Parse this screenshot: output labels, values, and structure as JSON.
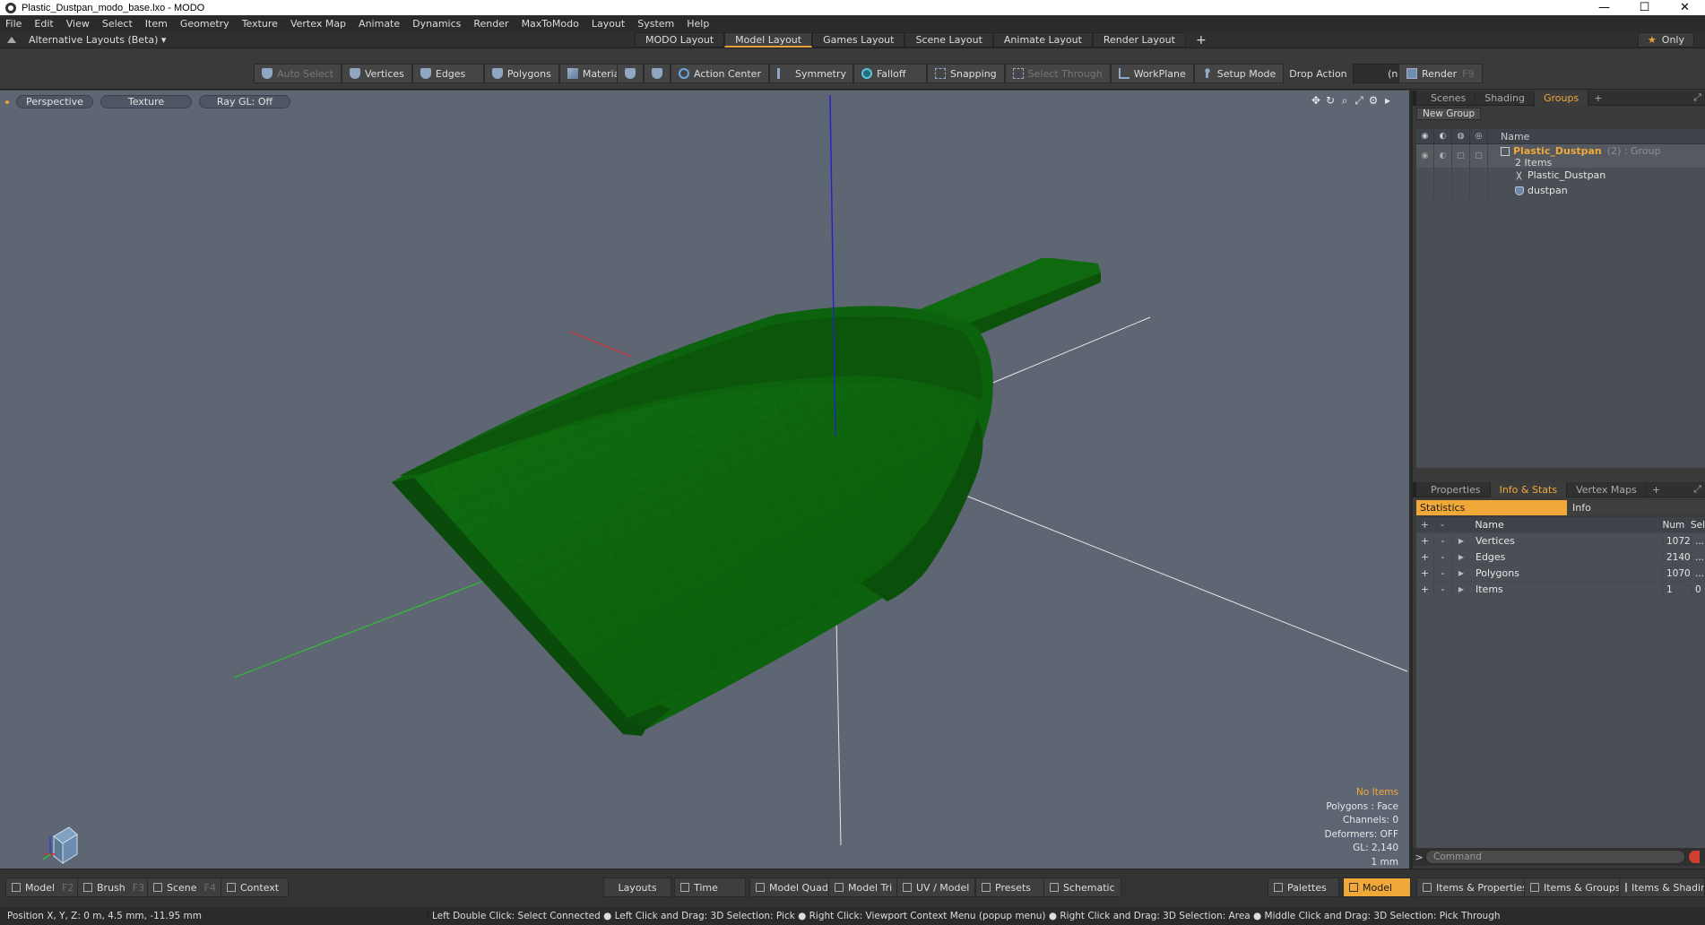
{
  "window": {
    "title": "Plastic_Dustpan_modo_base.lxo - MODO",
    "controls": [
      "—",
      "☐",
      "✕"
    ]
  },
  "menu": [
    "File",
    "Edit",
    "View",
    "Select",
    "Item",
    "Geometry",
    "Texture",
    "Vertex Map",
    "Animate",
    "Dynamics",
    "Render",
    "MaxToModo",
    "Layout",
    "System",
    "Help"
  ],
  "layoutbar": {
    "alt_layouts": "Alternative Layouts (Beta) ▾",
    "tabs": [
      "MODO Layout",
      "Model Layout",
      "Games Layout",
      "Scene Layout",
      "Animate Layout",
      "Render Layout"
    ],
    "active_tab": "Model Layout",
    "add": "+",
    "only": "Only"
  },
  "toolbar": {
    "auto_select": "Auto Select",
    "vertices": "Vertices",
    "edges": "Edges",
    "polygons": "Polygons",
    "materials": "Materials",
    "action_center": "Action Center",
    "symmetry": "Symmetry",
    "falloff": "Falloff",
    "snapping": "Snapping",
    "select_through": "Select Through",
    "workplane": "WorkPlane",
    "setup_mode": "Setup Mode",
    "drop_action_label": "Drop Action",
    "drop_action_value": "(none)",
    "render": "Render",
    "render_key": "F9"
  },
  "viewport": {
    "view": "Perspective",
    "shading": "Texture",
    "raygl": "Ray GL: Off",
    "info": {
      "selection": "No Items",
      "polygons": "Polygons : Face",
      "channels": "Channels: 0",
      "deformers": "Deformers: OFF",
      "gl": "GL: 2,140",
      "unit": "1 mm"
    },
    "colors": {
      "background": "#5e6674",
      "mesh": "#0f6b0f",
      "x_axis": "#d03030",
      "y_axis": "#2222cc",
      "z_axis": "#30c030"
    }
  },
  "groups_panel": {
    "tabs": [
      "Scenes",
      "Shading",
      "Groups"
    ],
    "active_tab": "Groups",
    "new_group": "New Group",
    "name_header": "Name",
    "group": {
      "name": "Plastic_Dustpan",
      "meta": "(2) : Group",
      "count": "2 Items",
      "children": [
        "Plastic_Dustpan",
        "dustpan"
      ]
    }
  },
  "stats_panel": {
    "tabs": [
      "Properties",
      "Info & Stats",
      "Vertex Maps"
    ],
    "active_tab": "Info & Stats",
    "statistics": "Statistics",
    "info": "Info",
    "headers": {
      "name": "Name",
      "num": "Num",
      "sel": "Sel"
    },
    "rows": [
      {
        "name": "Vertices",
        "num": "1072",
        "sel": "..."
      },
      {
        "name": "Edges",
        "num": "2140",
        "sel": "..."
      },
      {
        "name": "Polygons",
        "num": "1070",
        "sel": "..."
      },
      {
        "name": "Items",
        "num": "1",
        "sel": "0"
      }
    ]
  },
  "command": {
    "placeholder": "Command"
  },
  "bottombar": {
    "model": "Model",
    "model_key": "F2",
    "brush": "Brush",
    "brush_key": "F3",
    "scene": "Scene",
    "scene_key": "F4",
    "context": "Context",
    "layouts": "Layouts",
    "time": "Time",
    "model_quad": "Model Quad",
    "model_tri": "Model Tri",
    "uv_model": "UV / Model",
    "presets": "Presets",
    "schematic": "Schematic",
    "palettes": "Palettes",
    "model_active": "Model",
    "items_properties": "Items & Properties",
    "items_groups": "Items & Groups",
    "items_shading": "Items & Shading"
  },
  "status": {
    "position": "Position X, Y, Z:   0 m, 4.5 mm, -11.95 mm",
    "hints": "Left Double Click: Select Connected ● Left Click and Drag: 3D Selection: Pick ● Right Click: Viewport Context Menu (popup menu) ● Right Click and Drag: 3D Selection: Area ● Middle Click and Drag: 3D Selection: Pick Through"
  }
}
